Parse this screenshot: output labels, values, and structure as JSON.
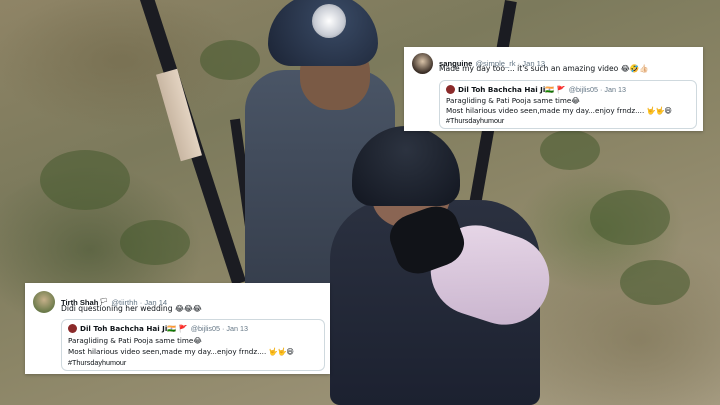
{
  "tweet_top": {
    "author_name": "sanguine",
    "author_handle": "@simple_rk · Jan 13",
    "text": "Made my day too ... it's such an amazing video 😂🤣👍🏻",
    "quote": {
      "author_name": "Dil Toh Bachcha Hai Ji🇮🇳 🚩",
      "author_handle": "@bijlis05 · Jan 13",
      "line1": "Paragliding & Pati Pooja same time😂",
      "line2": "Most hilarious video seen,made my day...enjoy frndz.... 🤟🤟😄",
      "line3": "#Thursdayhumour"
    }
  },
  "tweet_bottom": {
    "author_name": "Tirth Shah",
    "author_badge": "🏳",
    "author_handle": "@tiirthh · Jan 14",
    "text": "Didi questioning her wedding 😂😂😂",
    "quote": {
      "author_name": "Dil Toh Bachcha Hai Ji🇮🇳 🚩",
      "author_handle": "@bijlis05 · Jan 13",
      "line1": "Paragliding & Pati Pooja same time😂",
      "line2": "Most hilarious video seen,made my day...enjoy frndz.... 🤟🤟😄",
      "line3": "#Thursdayhumour"
    }
  },
  "colors": {
    "card_background": "#ffffff",
    "text_primary": "#0f1419",
    "text_secondary": "#657786",
    "quote_border": "#cfd9de"
  }
}
